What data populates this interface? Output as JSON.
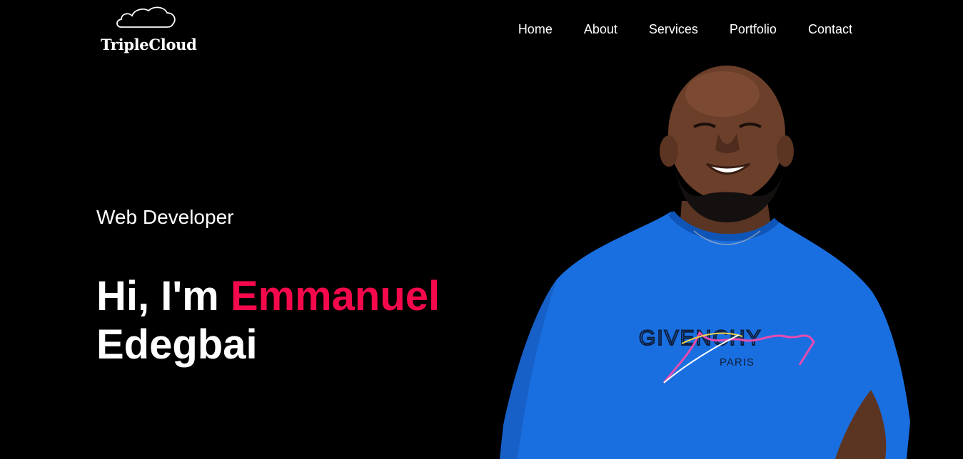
{
  "header": {
    "logo_text": "TripleCloud",
    "logo_icon": "cloud-icon"
  },
  "nav": {
    "items": [
      {
        "label": "Home"
      },
      {
        "label": "About"
      },
      {
        "label": "Services"
      },
      {
        "label": "Portfolio"
      },
      {
        "label": "Contact"
      }
    ]
  },
  "hero": {
    "role": "Web Developer",
    "greeting": "Hi, I'm",
    "first_name": "Emmanuel",
    "last_name": "Edegbai",
    "portrait": {
      "shirt_brand": "GIVENCHY",
      "shirt_city": "PARIS"
    }
  },
  "colors": {
    "background": "#000000",
    "text": "#ffffff",
    "accent": "#f6094c",
    "shirt": "#1a6fe0"
  }
}
